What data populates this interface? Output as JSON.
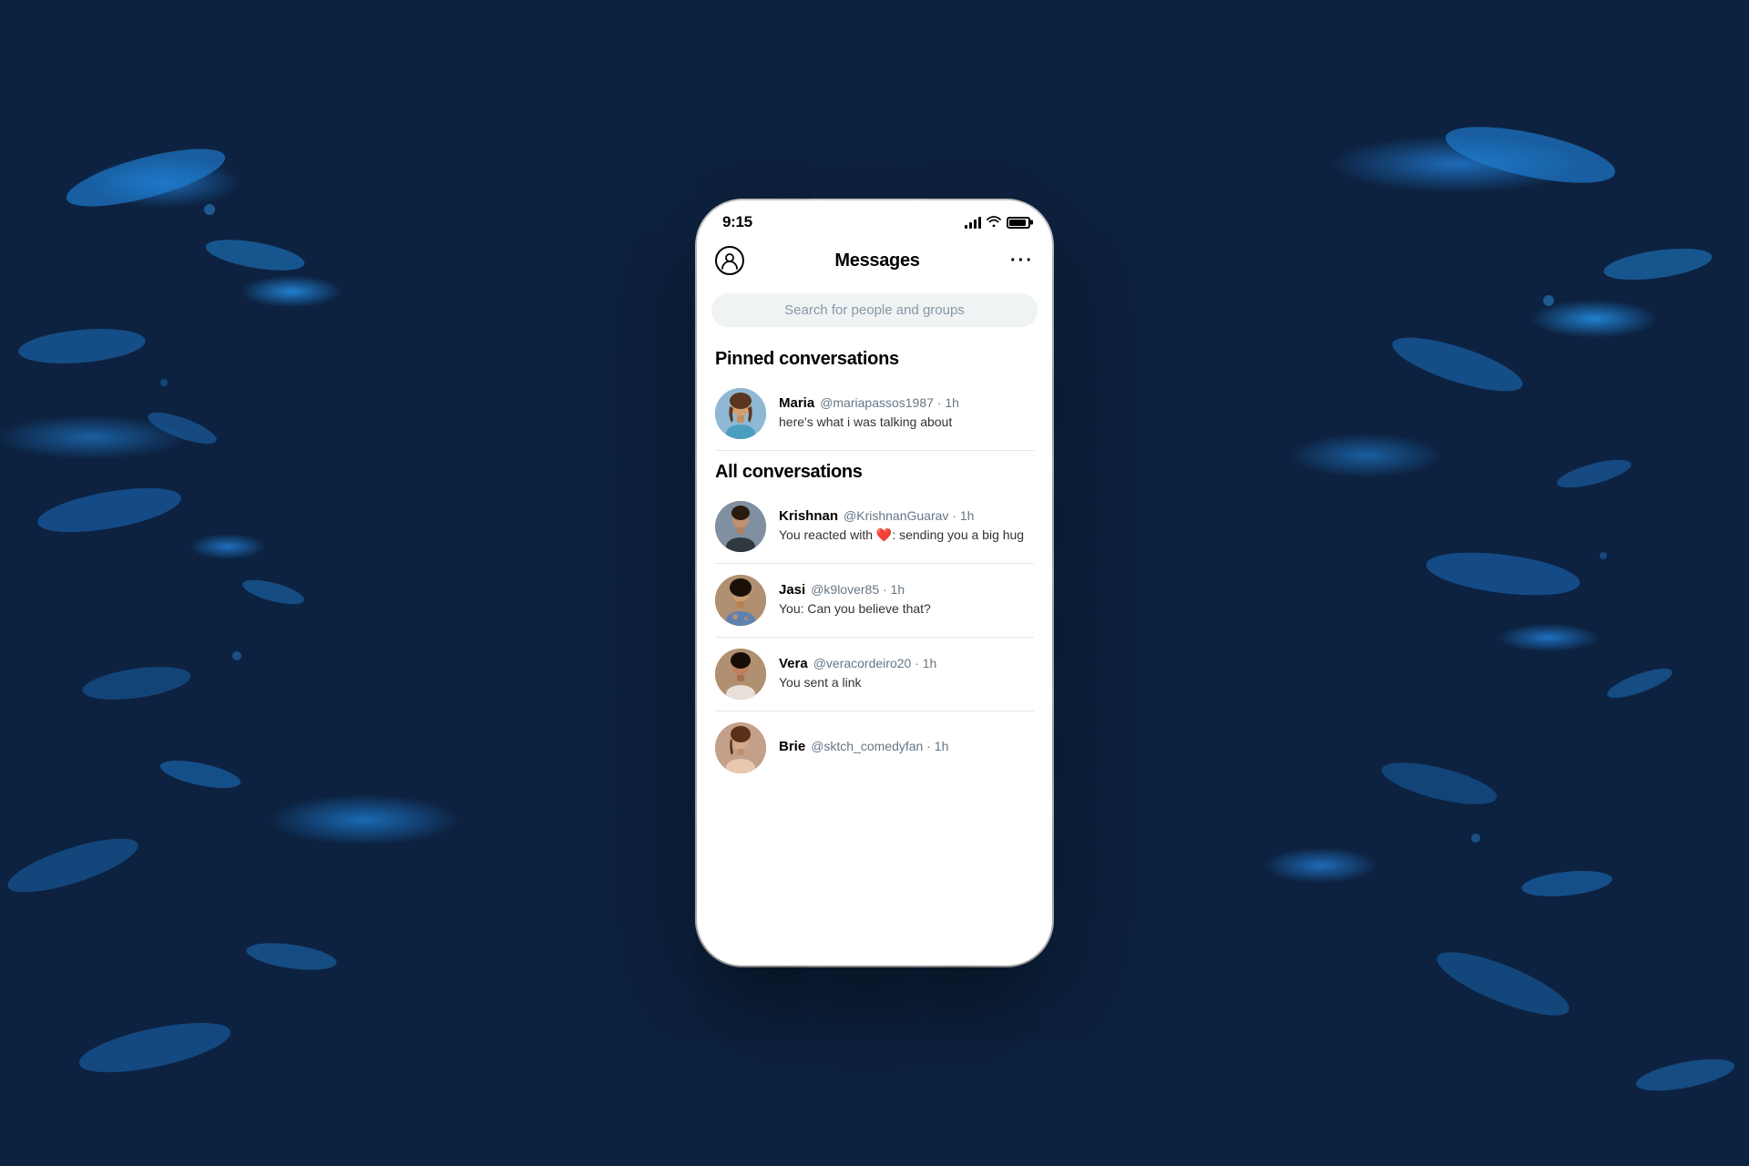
{
  "background": {
    "color": "#0d2240"
  },
  "status_bar": {
    "time": "9:15",
    "signal_label": "signal",
    "wifi_label": "wifi",
    "battery_label": "battery"
  },
  "header": {
    "title": "Messages",
    "profile_icon": "person",
    "more_icon": "···"
  },
  "search": {
    "placeholder": "Search for people and groups"
  },
  "pinned_section": {
    "title": "Pinned conversations",
    "conversations": [
      {
        "name": "Maria",
        "handle": "@mariapassos1987",
        "time": "1h",
        "preview": "here's what i was talking about",
        "avatar_type": "maria"
      }
    ]
  },
  "all_section": {
    "title": "All conversations",
    "conversations": [
      {
        "name": "Krishnan",
        "handle": "@KrishnanGuarav",
        "time": "1h",
        "preview": "You reacted with ❤️: sending you a big hug",
        "avatar_type": "krishnan"
      },
      {
        "name": "Jasi",
        "handle": "@k9lover85",
        "time": "1h",
        "preview": "You: Can you believe that?",
        "avatar_type": "jasi"
      },
      {
        "name": "Vera",
        "handle": "@veracordeiro20",
        "time": "1h",
        "preview": "You sent a link",
        "avatar_type": "vera"
      },
      {
        "name": "Brie",
        "handle": "@sktch_comedyfan",
        "time": "1h",
        "preview": "",
        "avatar_type": "brie"
      }
    ]
  }
}
